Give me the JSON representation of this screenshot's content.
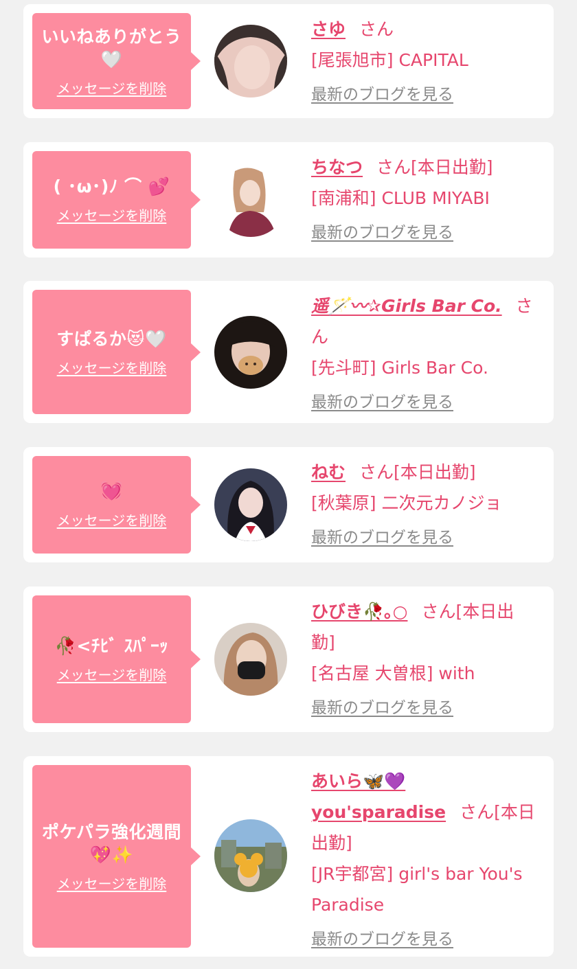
{
  "common": {
    "delete_label": "メッセージを削除",
    "blog_label": "最新のブログを見る"
  },
  "colors": {
    "background": "#f1f1f1",
    "card": "#ffffff",
    "bubble": "#fd8c9f",
    "accent_text": "#e6466d",
    "muted_link": "#8a8a8a"
  },
  "items": [
    {
      "message": "いいねありがとう🤍",
      "name": "さゆ",
      "suffix": "さん",
      "shop": "[尾張旭市] CAPITAL"
    },
    {
      "message": "( ･ω･)ﾉ ⌒ 💕",
      "name": "ちなつ",
      "suffix": "さん[本日出勤]",
      "shop": "[南浦和] CLUB MIYABI"
    },
    {
      "message": "すぱるか😻🤍",
      "name": "遥🪄〰✰Girls Bar Co.",
      "suffix": "さん",
      "shop": "[先斗町] Girls Bar Co."
    },
    {
      "message": "💓",
      "name": "ねむ",
      "suffix": "さん[本日出勤]",
      "shop": "[秋葉原] 二次元カノジョ"
    },
    {
      "message": "🥀<ﾁﾋﾞ ｽﾊﾟｰｯ",
      "name": "ひびき🥀｡○",
      "suffix": "さん[本日出勤]",
      "shop": "[名古屋 大曽根] with"
    },
    {
      "message": "ポケパラ強化週間💖✨",
      "name": "あいら🦋💜 you'sparadise",
      "suffix": "さん[本日出勤]",
      "shop": "[JR宇都宮] girl's bar You's Paradise"
    }
  ]
}
